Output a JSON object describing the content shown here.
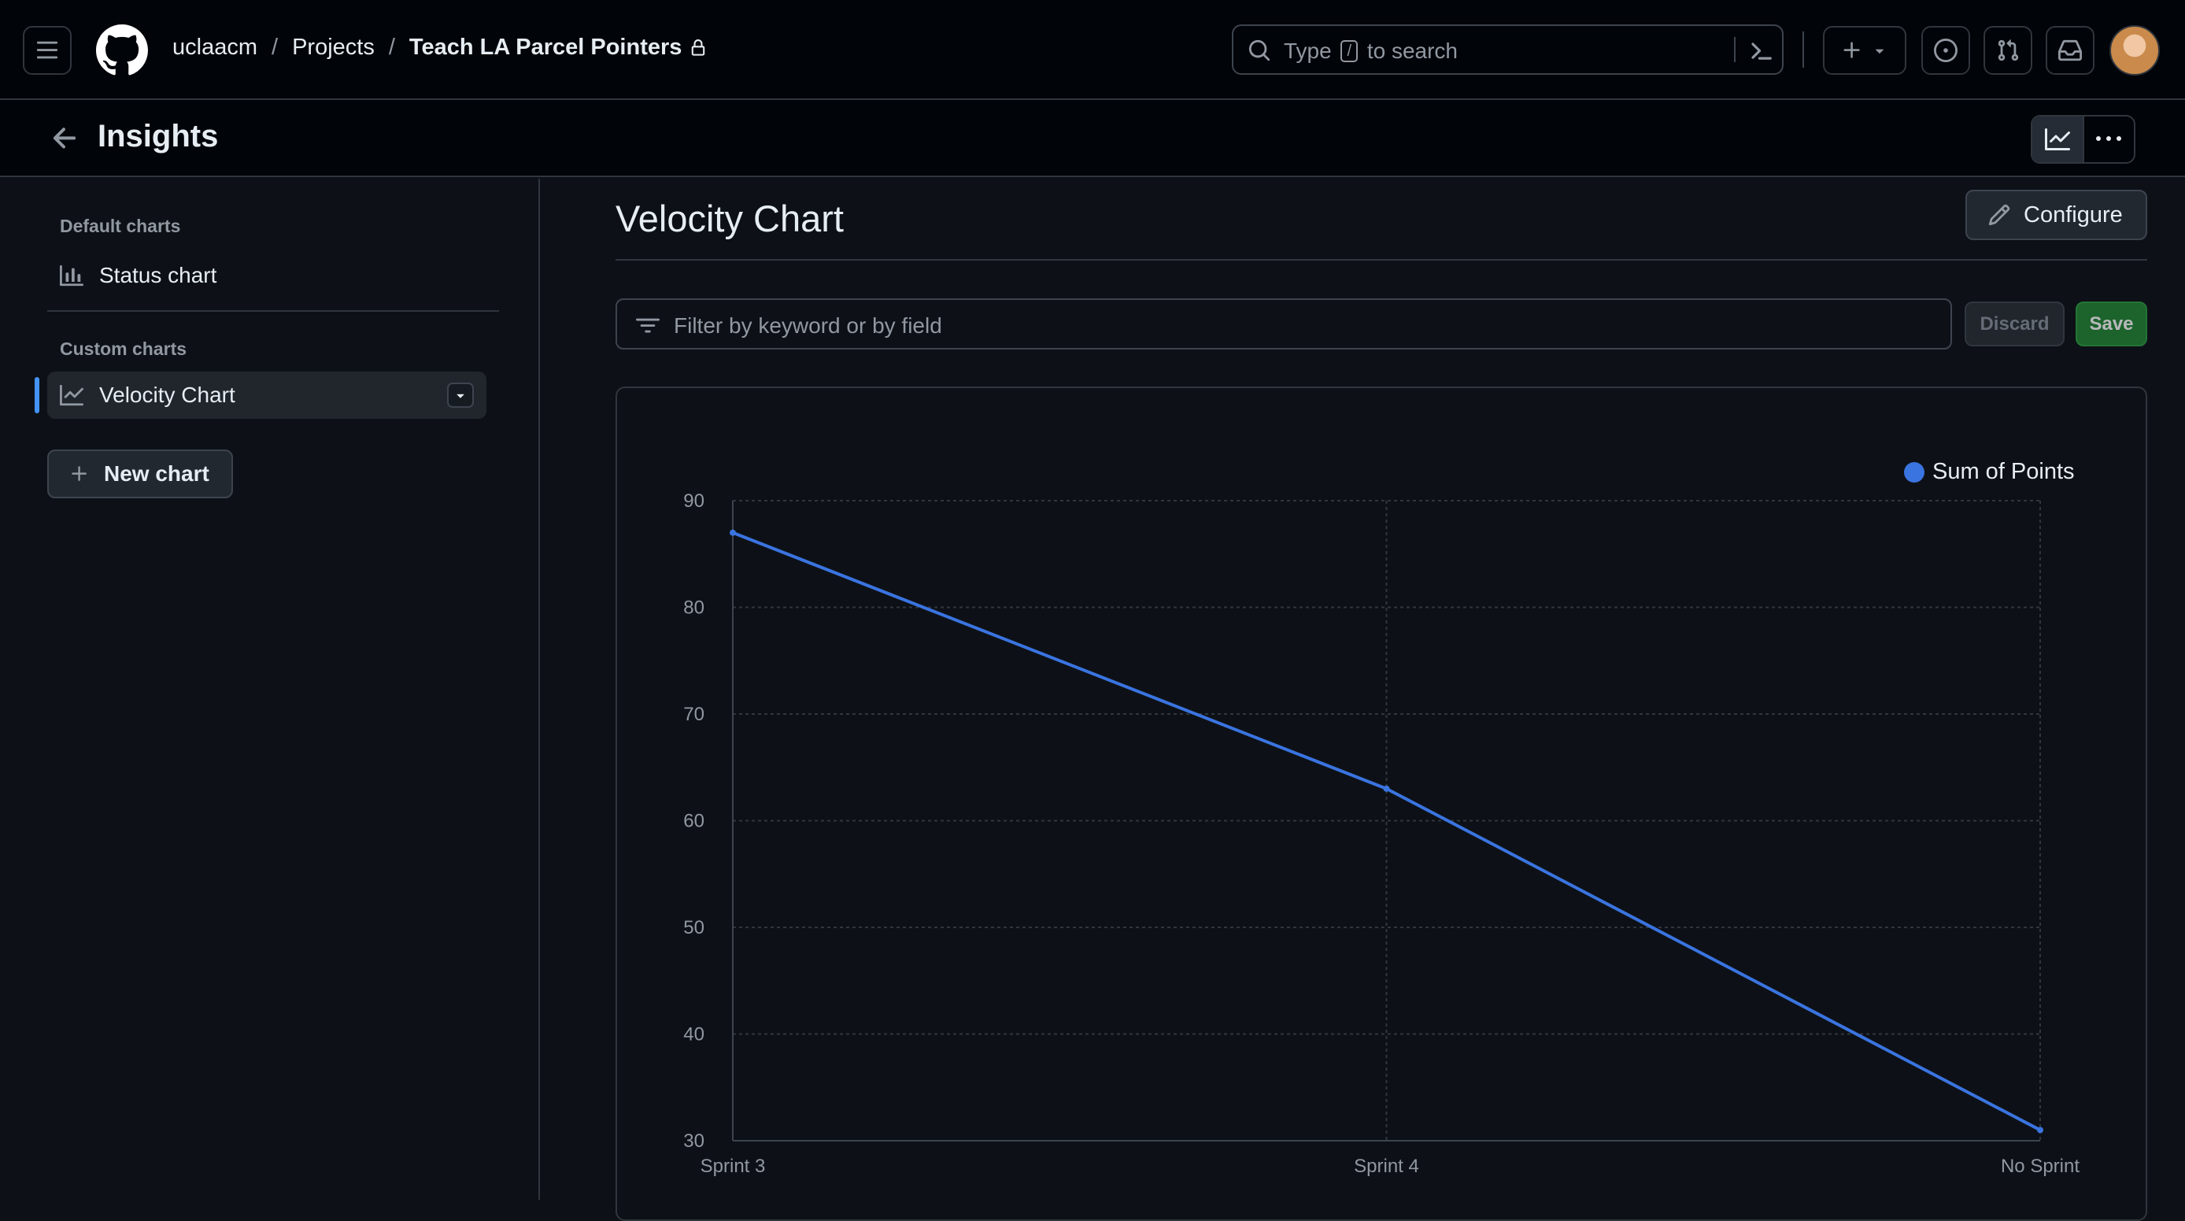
{
  "header": {
    "breadcrumb": {
      "org": "uclaacm",
      "sep1": "/",
      "section": "Projects",
      "sep2": "/",
      "project": "Teach LA Parcel Pointers"
    },
    "search": {
      "pre": "Type",
      "key": "/",
      "post": "to search"
    },
    "icons": [
      "menu-icon",
      "github-logo",
      "lock-icon",
      "search-icon",
      "command-palette-icon",
      "plus-icon",
      "chevron-down-icon",
      "issues-icon",
      "pull-request-icon",
      "inbox-icon",
      "avatar"
    ]
  },
  "subheader": {
    "title": "Insights"
  },
  "sidebar": {
    "default_label": "Default charts",
    "default_items": [
      {
        "label": "Status chart",
        "icon": "bar-chart-icon"
      }
    ],
    "custom_label": "Custom charts",
    "custom_items": [
      {
        "label": "Velocity Chart",
        "icon": "line-chart-icon",
        "active": true
      }
    ],
    "new_chart_label": "New chart"
  },
  "main": {
    "title": "Velocity Chart",
    "configure_label": "Configure",
    "filter_placeholder": "Filter by keyword or by field",
    "discard_label": "Discard",
    "save_label": "Save"
  },
  "colors": {
    "accent": "#4493f8",
    "series": "#3a74e0",
    "save": "#238636",
    "bg": "#0d1117"
  },
  "chart_data": {
    "type": "line",
    "categories": [
      "Sprint 3",
      "Sprint 4",
      "No Sprint"
    ],
    "series": [
      {
        "name": "Sum of Points",
        "values": [
          87,
          63,
          31
        ]
      }
    ],
    "ylim": [
      30,
      90
    ],
    "yticks": [
      90,
      80,
      70,
      60,
      50,
      40,
      30
    ],
    "grid": true,
    "legend": "top-right"
  }
}
